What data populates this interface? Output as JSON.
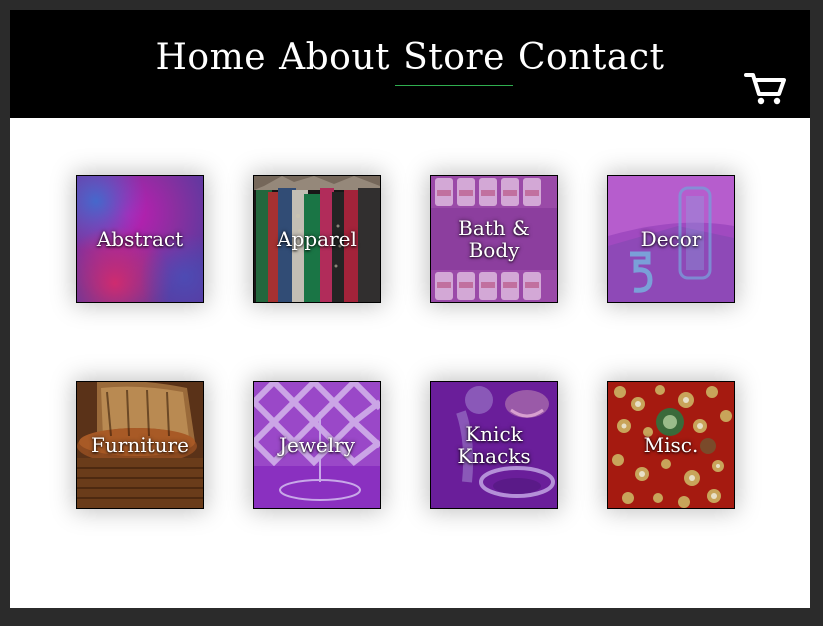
{
  "nav": {
    "items": [
      {
        "label": "Home"
      },
      {
        "label": "About"
      },
      {
        "label": "Store",
        "active": true
      },
      {
        "label": "Contact"
      }
    ],
    "cart_icon": "shopping-cart-icon",
    "accent_color": "#2fae4f"
  },
  "categories": [
    {
      "label": "Abstract"
    },
    {
      "label": "Apparel"
    },
    {
      "label": "Bath & Body"
    },
    {
      "label": "Decor"
    },
    {
      "label": "Furniture"
    },
    {
      "label": "Jewelry"
    },
    {
      "label": "Knick Knacks"
    },
    {
      "label": "Misc."
    }
  ]
}
